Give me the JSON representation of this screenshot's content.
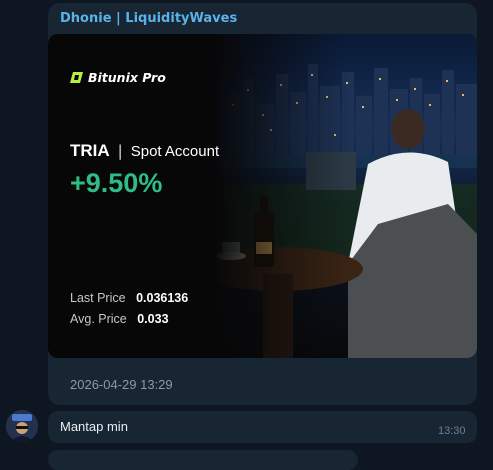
{
  "message": {
    "sender": "Dhonie | LiquidityWaves",
    "card": {
      "brand": "Bitunix Pro",
      "symbol": "TRIA",
      "account_type": "Spot Account",
      "pnl_percent": "+9.50%",
      "last_price_label": "Last Price",
      "last_price": "0.036136",
      "avg_price_label": "Avg. Price",
      "avg_price": "0.033"
    },
    "timestamp": "2026-04-29 13:29"
  },
  "reply": {
    "text": "Mantap min",
    "time": "13:30"
  },
  "colors": {
    "background": "#0e1621",
    "bubble": "#182533",
    "sender": "#5ab3e8",
    "pnl_green": "#2ebd85"
  }
}
